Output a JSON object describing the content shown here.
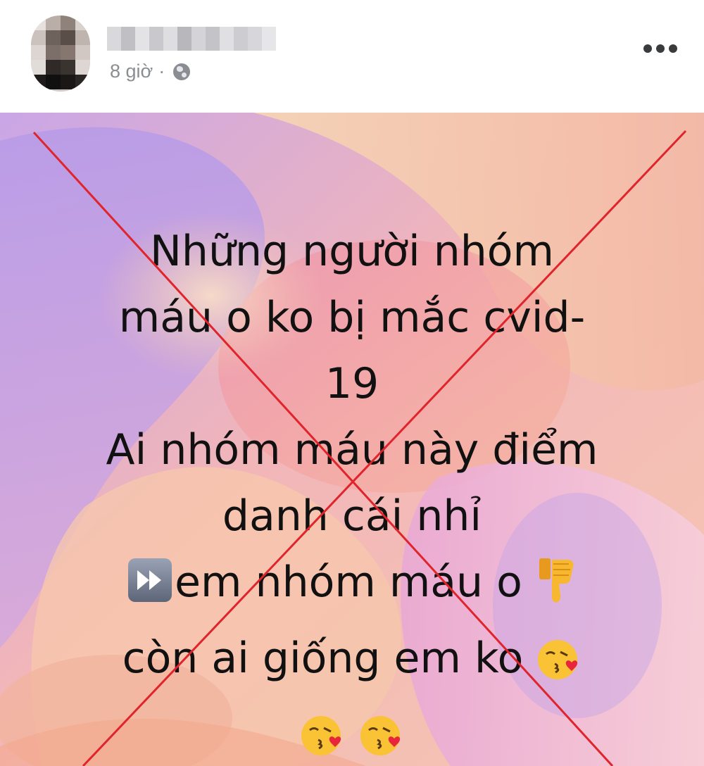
{
  "post": {
    "timestamp": "8 giờ",
    "separator": "·",
    "privacy_icon": "globe-icon",
    "more_icon": "more-options-icon",
    "author_name_blurred": true
  },
  "photo": {
    "lines": [
      "Những người nhóm",
      "máu o ko bị mắc cvid-",
      "19",
      "Ai nhóm máu này điểm",
      "danh cái nhỉ",
      "em nhóm máu o",
      "còn ai giống em ko"
    ],
    "icons": {
      "fast_forward": "fast-forward-emoji",
      "thumb": "thumbs-down-emoji",
      "kiss": "face-blowing-kiss-emoji"
    },
    "overlay": "red-x-cross",
    "colors": {
      "cross": "#e0242c",
      "text": "#111111"
    }
  }
}
